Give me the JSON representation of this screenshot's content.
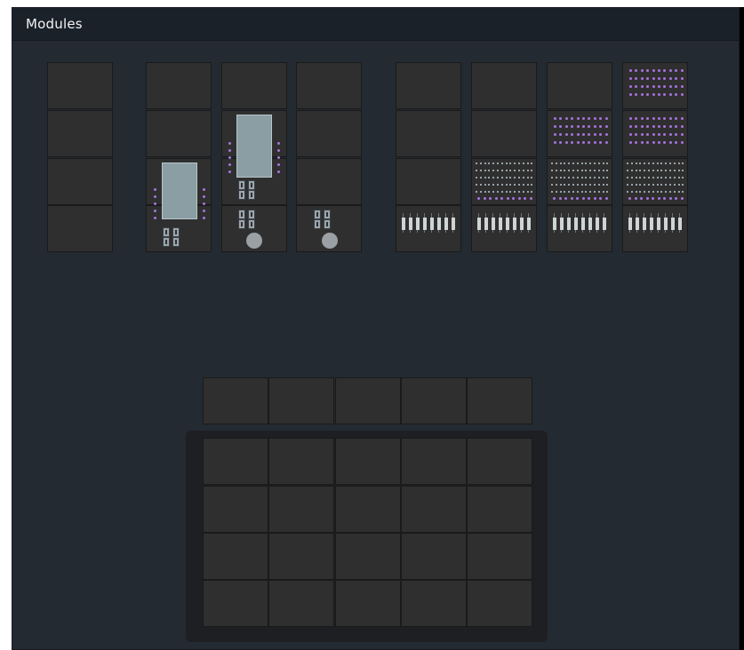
{
  "window": {
    "title": "Modules"
  },
  "colors": {
    "panel_bg": "#232a32",
    "titlebar_bg": "#1b2128",
    "slot_bg": "#2f2f2f",
    "screen_color": "#8b9ea4",
    "accent_dot": "#a874e0",
    "tray_bg": "#1d1f22"
  },
  "modules": {
    "column_count": 8,
    "row_count": 4,
    "palette_row_slots": 5,
    "grid_rows": 4,
    "grid_cols": 5
  }
}
